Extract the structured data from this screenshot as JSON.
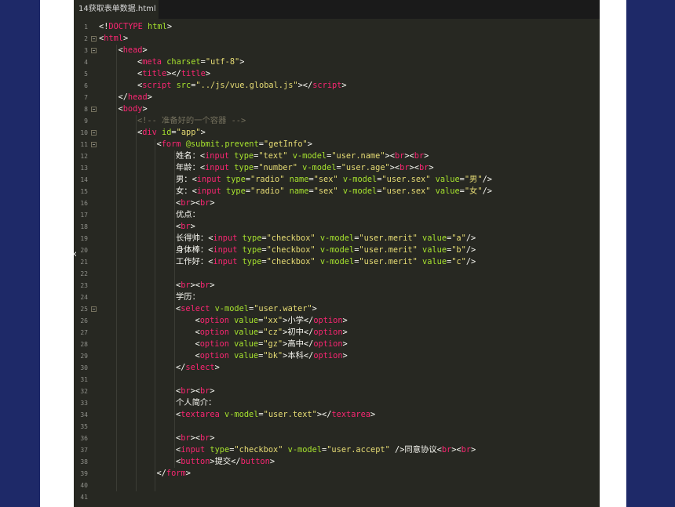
{
  "tab": {
    "title": "14获取表单数据.html"
  },
  "lines": [
    {
      "n": "1",
      "indent": 0,
      "fold": false,
      "parts": [
        [
          "p",
          "<!"
        ],
        [
          "t",
          "DOCTYPE"
        ],
        [
          "p",
          " "
        ],
        [
          "a",
          "html"
        ],
        [
          "p",
          ">"
        ]
      ]
    },
    {
      "n": "2",
      "indent": 0,
      "fold": true,
      "parts": [
        [
          "p",
          "<"
        ],
        [
          "t",
          "html"
        ],
        [
          "p",
          ">"
        ]
      ]
    },
    {
      "n": "3",
      "indent": 1,
      "fold": true,
      "parts": [
        [
          "p",
          "<"
        ],
        [
          "t",
          "head"
        ],
        [
          "p",
          ">"
        ]
      ]
    },
    {
      "n": "4",
      "indent": 2,
      "fold": false,
      "parts": [
        [
          "p",
          "<"
        ],
        [
          "t",
          "meta"
        ],
        [
          "p",
          " "
        ],
        [
          "a",
          "charset"
        ],
        [
          "p",
          "="
        ],
        [
          "s",
          "\"utf-8\""
        ],
        [
          "p",
          ">"
        ]
      ]
    },
    {
      "n": "5",
      "indent": 2,
      "fold": false,
      "parts": [
        [
          "p",
          "<"
        ],
        [
          "t",
          "title"
        ],
        [
          "p",
          "></"
        ],
        [
          "t",
          "title"
        ],
        [
          "p",
          ">"
        ]
      ]
    },
    {
      "n": "6",
      "indent": 2,
      "fold": false,
      "parts": [
        [
          "p",
          "<"
        ],
        [
          "t",
          "script"
        ],
        [
          "p",
          " "
        ],
        [
          "a",
          "src"
        ],
        [
          "p",
          "="
        ],
        [
          "s",
          "\"../js/vue.global.js\""
        ],
        [
          "p",
          "></"
        ],
        [
          "t",
          "script"
        ],
        [
          "p",
          ">"
        ]
      ]
    },
    {
      "n": "7",
      "indent": 1,
      "fold": false,
      "parts": [
        [
          "p",
          "</"
        ],
        [
          "t",
          "head"
        ],
        [
          "p",
          ">"
        ]
      ]
    },
    {
      "n": "8",
      "indent": 1,
      "fold": true,
      "parts": [
        [
          "p",
          "<"
        ],
        [
          "t",
          "body"
        ],
        [
          "p",
          ">"
        ]
      ]
    },
    {
      "n": "9",
      "indent": 2,
      "fold": false,
      "parts": [
        [
          "c",
          "<!-- 准备好的一个容器 -->"
        ]
      ]
    },
    {
      "n": "10",
      "indent": 2,
      "fold": true,
      "parts": [
        [
          "p",
          "<"
        ],
        [
          "t",
          "div"
        ],
        [
          "p",
          " "
        ],
        [
          "a",
          "id"
        ],
        [
          "p",
          "="
        ],
        [
          "s",
          "\"app\""
        ],
        [
          "p",
          ">"
        ]
      ]
    },
    {
      "n": "11",
      "indent": 3,
      "fold": true,
      "parts": [
        [
          "p",
          "<"
        ],
        [
          "t",
          "form"
        ],
        [
          "p",
          " "
        ],
        [
          "a",
          "@submit.prevent"
        ],
        [
          "p",
          "="
        ],
        [
          "s",
          "\"getInfo\""
        ],
        [
          "p",
          ">"
        ]
      ]
    },
    {
      "n": "12",
      "indent": 4,
      "fold": false,
      "parts": [
        [
          "p",
          "姓名："
        ],
        [
          "p",
          "<"
        ],
        [
          "t",
          "input"
        ],
        [
          "p",
          " "
        ],
        [
          "a",
          "type"
        ],
        [
          "p",
          "="
        ],
        [
          "s",
          "\"text\""
        ],
        [
          "p",
          " "
        ],
        [
          "a",
          "v-model"
        ],
        [
          "p",
          "="
        ],
        [
          "s",
          "\"user.name\""
        ],
        [
          "p",
          "><"
        ],
        [
          "t",
          "br"
        ],
        [
          "p",
          "><"
        ],
        [
          "t",
          "br"
        ],
        [
          "p",
          ">"
        ]
      ]
    },
    {
      "n": "13",
      "indent": 4,
      "fold": false,
      "parts": [
        [
          "p",
          "年龄："
        ],
        [
          "p",
          "<"
        ],
        [
          "t",
          "input"
        ],
        [
          "p",
          " "
        ],
        [
          "a",
          "type"
        ],
        [
          "p",
          "="
        ],
        [
          "s",
          "\"number\""
        ],
        [
          "p",
          " "
        ],
        [
          "a",
          "v-model"
        ],
        [
          "p",
          "="
        ],
        [
          "s",
          "\"user.age\""
        ],
        [
          "p",
          "><"
        ],
        [
          "t",
          "br"
        ],
        [
          "p",
          "><"
        ],
        [
          "t",
          "br"
        ],
        [
          "p",
          ">"
        ]
      ]
    },
    {
      "n": "14",
      "indent": 4,
      "fold": false,
      "parts": [
        [
          "p",
          "男："
        ],
        [
          "p",
          "<"
        ],
        [
          "t",
          "input"
        ],
        [
          "p",
          " "
        ],
        [
          "a",
          "type"
        ],
        [
          "p",
          "="
        ],
        [
          "s",
          "\"radio\""
        ],
        [
          "p",
          " "
        ],
        [
          "a",
          "name"
        ],
        [
          "p",
          "="
        ],
        [
          "s",
          "\"sex\""
        ],
        [
          "p",
          " "
        ],
        [
          "a",
          "v-model"
        ],
        [
          "p",
          "="
        ],
        [
          "s",
          "\"user.sex\""
        ],
        [
          "p",
          " "
        ],
        [
          "a",
          "value"
        ],
        [
          "p",
          "="
        ],
        [
          "s",
          "\"男\""
        ],
        [
          "p",
          "/>"
        ]
      ]
    },
    {
      "n": "15",
      "indent": 4,
      "fold": false,
      "parts": [
        [
          "p",
          "女："
        ],
        [
          "p",
          "<"
        ],
        [
          "t",
          "input"
        ],
        [
          "p",
          " "
        ],
        [
          "a",
          "type"
        ],
        [
          "p",
          "="
        ],
        [
          "s",
          "\"radio\""
        ],
        [
          "p",
          " "
        ],
        [
          "a",
          "name"
        ],
        [
          "p",
          "="
        ],
        [
          "s",
          "\"sex\""
        ],
        [
          "p",
          " "
        ],
        [
          "a",
          "v-model"
        ],
        [
          "p",
          "="
        ],
        [
          "s",
          "\"user.sex\""
        ],
        [
          "p",
          " "
        ],
        [
          "a",
          "value"
        ],
        [
          "p",
          "="
        ],
        [
          "s",
          "\"女\""
        ],
        [
          "p",
          "/>"
        ]
      ]
    },
    {
      "n": "16",
      "indent": 4,
      "fold": false,
      "parts": [
        [
          "p",
          "<"
        ],
        [
          "t",
          "br"
        ],
        [
          "p",
          "><"
        ],
        [
          "t",
          "br"
        ],
        [
          "p",
          ">"
        ]
      ]
    },
    {
      "n": "17",
      "indent": 4,
      "fold": false,
      "parts": [
        [
          "p",
          "优点："
        ]
      ]
    },
    {
      "n": "18",
      "indent": 4,
      "fold": false,
      "parts": [
        [
          "p",
          "<"
        ],
        [
          "t",
          "br"
        ],
        [
          "p",
          ">"
        ]
      ]
    },
    {
      "n": "19",
      "indent": 4,
      "fold": false,
      "parts": [
        [
          "p",
          "长得帅："
        ],
        [
          "p",
          "<"
        ],
        [
          "t",
          "input"
        ],
        [
          "p",
          " "
        ],
        [
          "a",
          "type"
        ],
        [
          "p",
          "="
        ],
        [
          "s",
          "\"checkbox\""
        ],
        [
          "p",
          " "
        ],
        [
          "a",
          "v-model"
        ],
        [
          "p",
          "="
        ],
        [
          "s",
          "\"user.merit\""
        ],
        [
          "p",
          " "
        ],
        [
          "a",
          "value"
        ],
        [
          "p",
          "="
        ],
        [
          "s",
          "\"a\""
        ],
        [
          "p",
          "/>"
        ]
      ]
    },
    {
      "n": "20",
      "indent": 4,
      "fold": false,
      "parts": [
        [
          "p",
          "身体棒："
        ],
        [
          "p",
          "<"
        ],
        [
          "t",
          "input"
        ],
        [
          "p",
          " "
        ],
        [
          "a",
          "type"
        ],
        [
          "p",
          "="
        ],
        [
          "s",
          "\"checkbox\""
        ],
        [
          "p",
          " "
        ],
        [
          "a",
          "v-model"
        ],
        [
          "p",
          "="
        ],
        [
          "s",
          "\"user.merit\""
        ],
        [
          "p",
          " "
        ],
        [
          "a",
          "value"
        ],
        [
          "p",
          "="
        ],
        [
          "s",
          "\"b\""
        ],
        [
          "p",
          "/>"
        ]
      ]
    },
    {
      "n": "21",
      "indent": 4,
      "fold": false,
      "parts": [
        [
          "p",
          "工作好："
        ],
        [
          "p",
          "<"
        ],
        [
          "t",
          "input"
        ],
        [
          "p",
          " "
        ],
        [
          "a",
          "type"
        ],
        [
          "p",
          "="
        ],
        [
          "s",
          "\"checkbox\""
        ],
        [
          "p",
          " "
        ],
        [
          "a",
          "v-model"
        ],
        [
          "p",
          "="
        ],
        [
          "s",
          "\"user.merit\""
        ],
        [
          "p",
          " "
        ],
        [
          "a",
          "value"
        ],
        [
          "p",
          "="
        ],
        [
          "s",
          "\"c\""
        ],
        [
          "p",
          "/>"
        ]
      ]
    },
    {
      "n": "22",
      "indent": 4,
      "fold": false,
      "parts": []
    },
    {
      "n": "23",
      "indent": 4,
      "fold": false,
      "parts": [
        [
          "p",
          "<"
        ],
        [
          "t",
          "br"
        ],
        [
          "p",
          "><"
        ],
        [
          "t",
          "br"
        ],
        [
          "p",
          ">"
        ]
      ]
    },
    {
      "n": "24",
      "indent": 4,
      "fold": false,
      "parts": [
        [
          "p",
          "学历："
        ]
      ]
    },
    {
      "n": "25",
      "indent": 4,
      "fold": true,
      "parts": [
        [
          "p",
          "<"
        ],
        [
          "t",
          "select"
        ],
        [
          "p",
          " "
        ],
        [
          "a",
          "v-model"
        ],
        [
          "p",
          "="
        ],
        [
          "s",
          "\"user.water\""
        ],
        [
          "p",
          ">"
        ]
      ]
    },
    {
      "n": "26",
      "indent": 5,
      "fold": false,
      "parts": [
        [
          "p",
          "<"
        ],
        [
          "t",
          "option"
        ],
        [
          "p",
          " "
        ],
        [
          "a",
          "value"
        ],
        [
          "p",
          "="
        ],
        [
          "s",
          "\"xx\""
        ],
        [
          "p",
          ">小学</"
        ],
        [
          "t",
          "option"
        ],
        [
          "p",
          ">"
        ]
      ]
    },
    {
      "n": "27",
      "indent": 5,
      "fold": false,
      "parts": [
        [
          "p",
          "<"
        ],
        [
          "t",
          "option"
        ],
        [
          "p",
          " "
        ],
        [
          "a",
          "value"
        ],
        [
          "p",
          "="
        ],
        [
          "s",
          "\"cz\""
        ],
        [
          "p",
          ">初中</"
        ],
        [
          "t",
          "option"
        ],
        [
          "p",
          ">"
        ]
      ]
    },
    {
      "n": "28",
      "indent": 5,
      "fold": false,
      "parts": [
        [
          "p",
          "<"
        ],
        [
          "t",
          "option"
        ],
        [
          "p",
          " "
        ],
        [
          "a",
          "value"
        ],
        [
          "p",
          "="
        ],
        [
          "s",
          "\"gz\""
        ],
        [
          "p",
          ">高中</"
        ],
        [
          "t",
          "option"
        ],
        [
          "p",
          ">"
        ]
      ]
    },
    {
      "n": "29",
      "indent": 5,
      "fold": false,
      "parts": [
        [
          "p",
          "<"
        ],
        [
          "t",
          "option"
        ],
        [
          "p",
          " "
        ],
        [
          "a",
          "value"
        ],
        [
          "p",
          "="
        ],
        [
          "s",
          "\"bk\""
        ],
        [
          "p",
          ">本科</"
        ],
        [
          "t",
          "option"
        ],
        [
          "p",
          ">"
        ]
      ]
    },
    {
      "n": "30",
      "indent": 4,
      "fold": false,
      "parts": [
        [
          "p",
          "</"
        ],
        [
          "t",
          "select"
        ],
        [
          "p",
          ">"
        ]
      ]
    },
    {
      "n": "31",
      "indent": 4,
      "fold": false,
      "parts": []
    },
    {
      "n": "32",
      "indent": 4,
      "fold": false,
      "parts": [
        [
          "p",
          "<"
        ],
        [
          "t",
          "br"
        ],
        [
          "p",
          "><"
        ],
        [
          "t",
          "br"
        ],
        [
          "p",
          ">"
        ]
      ]
    },
    {
      "n": "33",
      "indent": 4,
      "fold": false,
      "parts": [
        [
          "p",
          "个人简介："
        ]
      ]
    },
    {
      "n": "34",
      "indent": 4,
      "fold": false,
      "parts": [
        [
          "p",
          "<"
        ],
        [
          "t",
          "textarea"
        ],
        [
          "p",
          " "
        ],
        [
          "a",
          "v-model"
        ],
        [
          "p",
          "="
        ],
        [
          "s",
          "\"user.text\""
        ],
        [
          "p",
          "></"
        ],
        [
          "t",
          "textarea"
        ],
        [
          "p",
          ">"
        ]
      ]
    },
    {
      "n": "35",
      "indent": 4,
      "fold": false,
      "parts": []
    },
    {
      "n": "36",
      "indent": 4,
      "fold": false,
      "parts": [
        [
          "p",
          "<"
        ],
        [
          "t",
          "br"
        ],
        [
          "p",
          "><"
        ],
        [
          "t",
          "br"
        ],
        [
          "p",
          ">"
        ]
      ]
    },
    {
      "n": "37",
      "indent": 4,
      "fold": false,
      "parts": [
        [
          "p",
          "<"
        ],
        [
          "t",
          "input"
        ],
        [
          "p",
          " "
        ],
        [
          "a",
          "type"
        ],
        [
          "p",
          "="
        ],
        [
          "s",
          "\"checkbox\""
        ],
        [
          "p",
          " "
        ],
        [
          "a",
          "v-model"
        ],
        [
          "p",
          "="
        ],
        [
          "s",
          "\"user.accept\""
        ],
        [
          "p",
          " />同意协议<"
        ],
        [
          "t",
          "br"
        ],
        [
          "p",
          "><"
        ],
        [
          "t",
          "br"
        ],
        [
          "p",
          ">"
        ]
      ]
    },
    {
      "n": "38",
      "indent": 4,
      "fold": false,
      "parts": [
        [
          "p",
          "<"
        ],
        [
          "t",
          "button"
        ],
        [
          "p",
          ">提交</"
        ],
        [
          "t",
          "button"
        ],
        [
          "p",
          ">"
        ]
      ]
    },
    {
      "n": "39",
      "indent": 3,
      "fold": false,
      "parts": [
        [
          "p",
          "</"
        ],
        [
          "t",
          "form"
        ],
        [
          "p",
          ">"
        ]
      ]
    },
    {
      "n": "40",
      "indent": 0,
      "fold": false,
      "parts": []
    },
    {
      "n": "41",
      "indent": 0,
      "fold": false,
      "parts": []
    }
  ],
  "caret_glyph": "‹"
}
